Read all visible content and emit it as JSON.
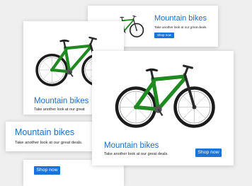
{
  "ad_cards": [
    {
      "title": "Mountain bikes",
      "subtitle": "Take another look at our great deals.",
      "button_label": "Shop now"
    },
    {
      "title": "Mountain bikes",
      "subtitle": "Take another look at our great"
    },
    {
      "title": "Mountain bikes",
      "subtitle": "Take another look at our great deals.",
      "button_label": "Shop now"
    },
    {
      "title": "Mountain bikes",
      "subtitle": "Take another look at our great deals."
    },
    {
      "button_label": "Shop now"
    }
  ],
  "images": {
    "product": "mountain-bike-image"
  },
  "colors": {
    "title_blue": "#1a6fc9",
    "button_blue": "#1a73d9",
    "bike_green": "#1f8a1f",
    "tire_black": "#1c1c1c",
    "card_background": "#ffffff",
    "page_background": "#efefef"
  }
}
